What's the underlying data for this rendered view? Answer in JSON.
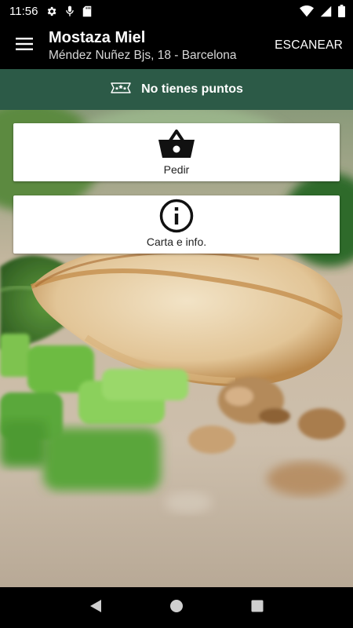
{
  "status_bar": {
    "time": "11:56",
    "left_icons": [
      "gear-icon",
      "microphone-icon",
      "sd-card-icon"
    ],
    "right_icons": [
      "wifi-icon",
      "cellular-signal-icon",
      "battery-icon"
    ]
  },
  "app_bar": {
    "menu_icon": "hamburger-menu-icon",
    "title": "Mostaza Miel",
    "subtitle": "Méndez Nuñez Bjs, 18 - Barcelona",
    "scan_label": "ESCANEAR"
  },
  "points_banner": {
    "icon": "stars-ribbon-icon",
    "text": "No tienes puntos",
    "background_color": "#2c5a47"
  },
  "actions": [
    {
      "label": "Pedir",
      "icon": "shopping-basket-icon"
    },
    {
      "label": "Carta e info.",
      "icon": "info-circle-icon"
    }
  ],
  "nav_bar": {
    "buttons": [
      "back-triangle-icon",
      "home-circle-icon",
      "recents-square-icon"
    ]
  }
}
